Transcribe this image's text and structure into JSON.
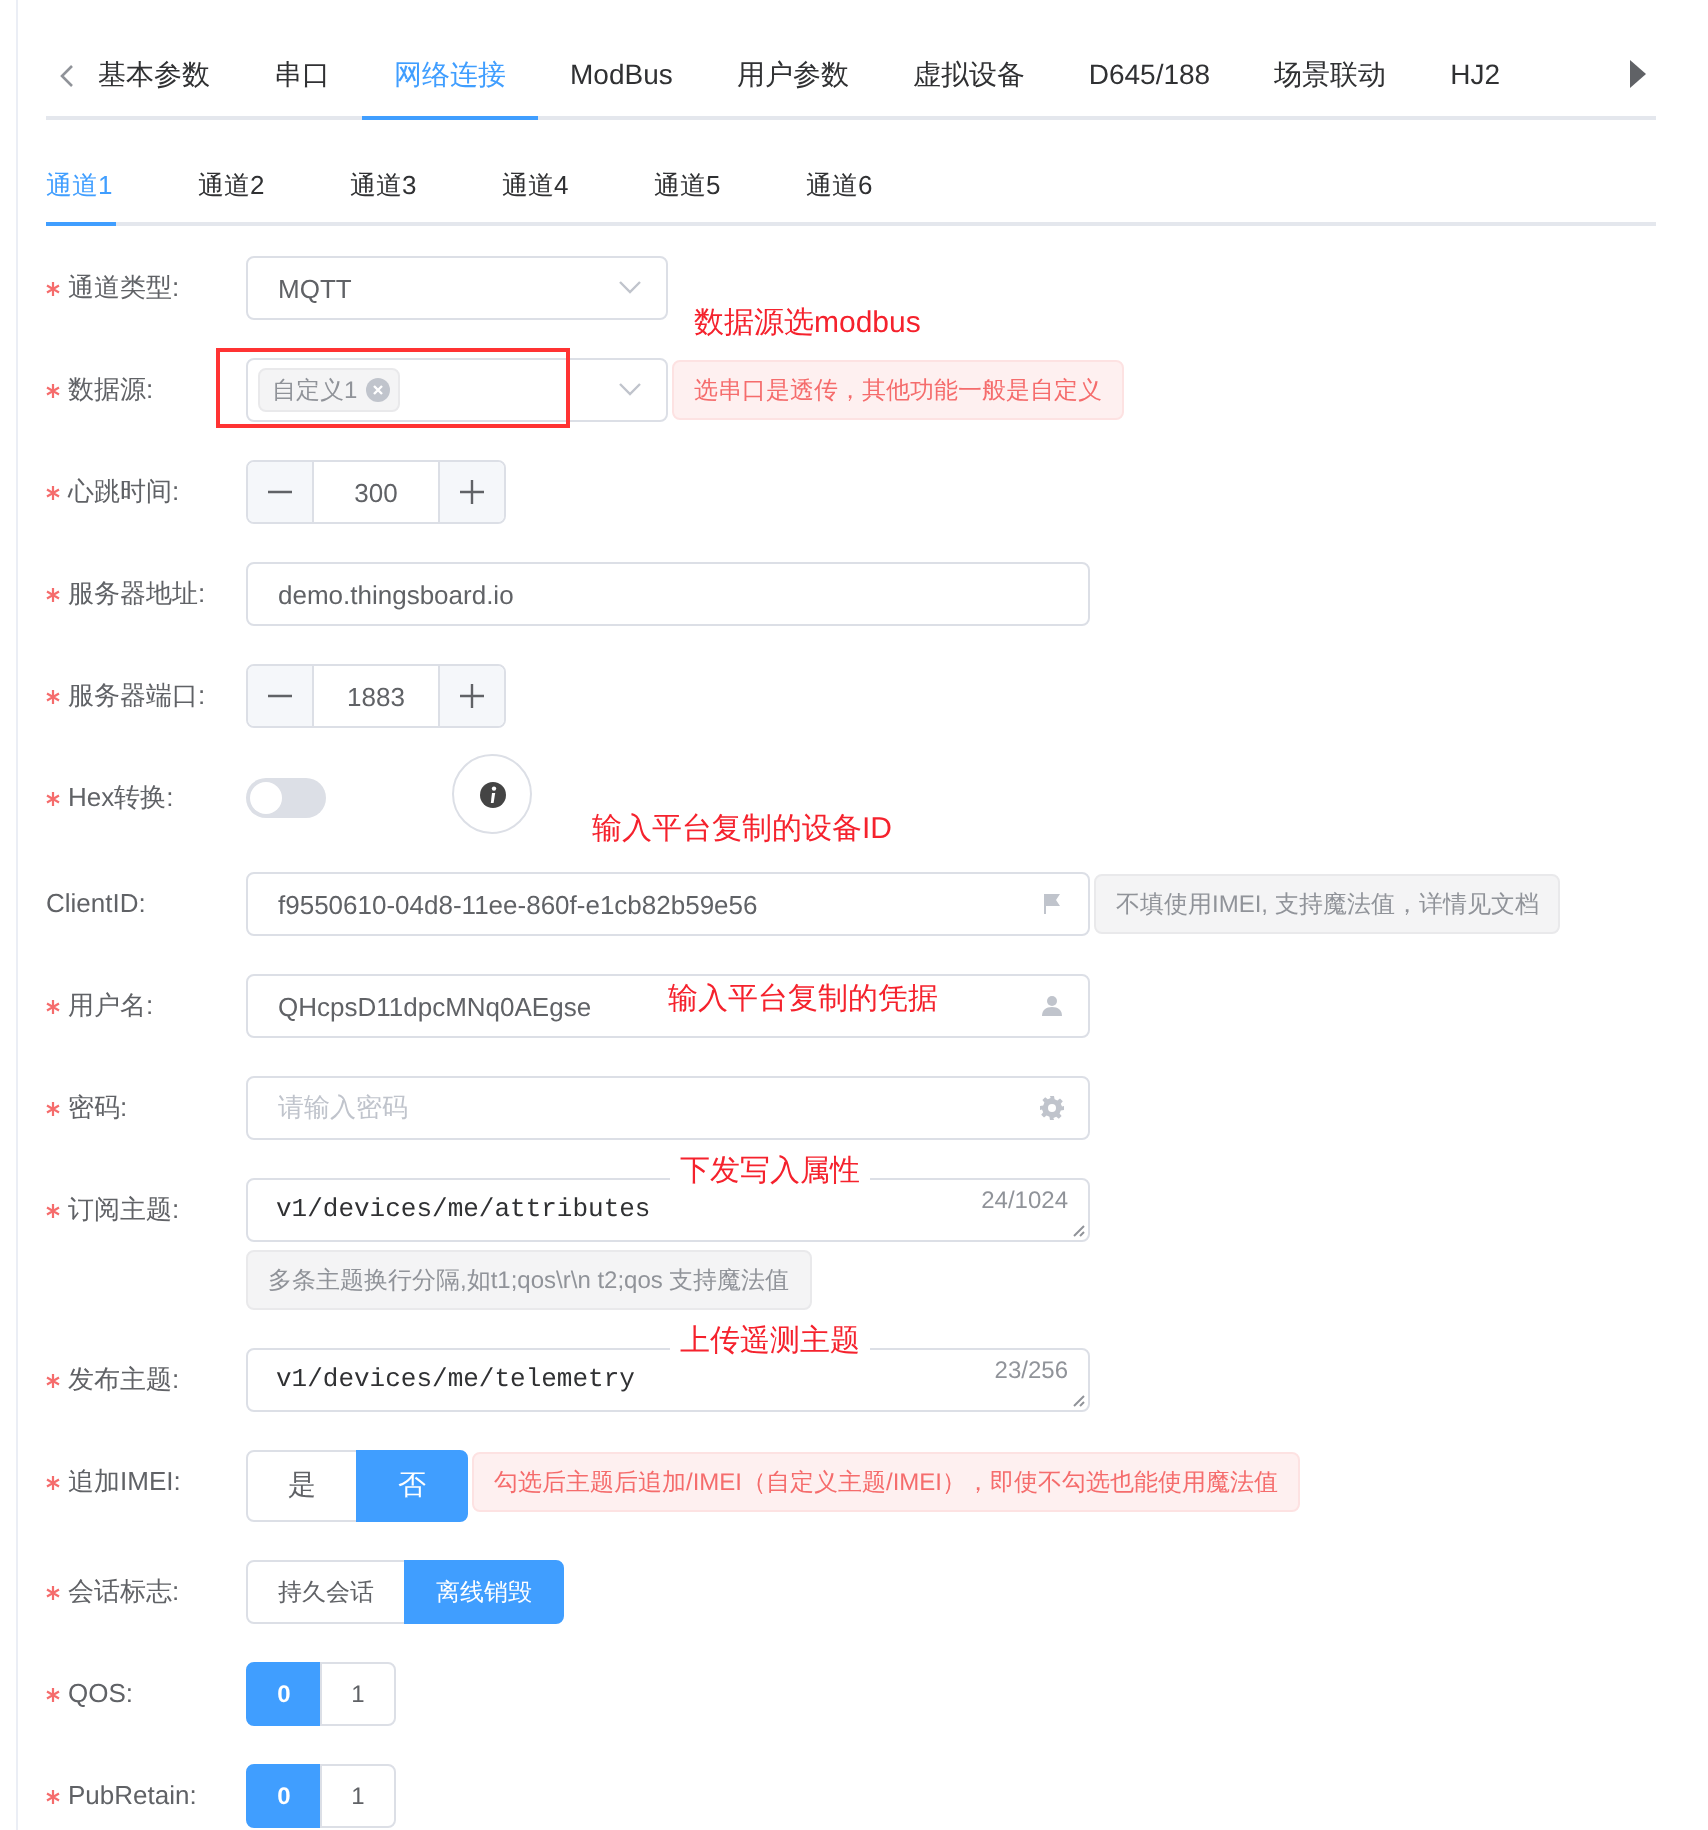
{
  "top_tabs": [
    {
      "label": "基本参数",
      "selected": false
    },
    {
      "label": "串口",
      "selected": false
    },
    {
      "label": "网络连接",
      "selected": true
    },
    {
      "label": "ModBus",
      "selected": false
    },
    {
      "label": "用户参数",
      "selected": false
    },
    {
      "label": "虚拟设备",
      "selected": false
    },
    {
      "label": "D645/188",
      "selected": false
    },
    {
      "label": "场景联动",
      "selected": false
    },
    {
      "label": "HJ2",
      "selected": false
    }
  ],
  "channel_tabs": [
    {
      "label": "通道1",
      "selected": true
    },
    {
      "label": "通道2",
      "selected": false
    },
    {
      "label": "通道3",
      "selected": false
    },
    {
      "label": "通道4",
      "selected": false
    },
    {
      "label": "通道5",
      "selected": false
    },
    {
      "label": "通道6",
      "selected": false
    }
  ],
  "form": [
    {
      "kind": "select",
      "label": "通道类型:",
      "required": true,
      "value": "MQTT",
      "annotation": "数据源选modbus"
    },
    {
      "kind": "tags",
      "label": "数据源:",
      "required": true,
      "tags": [
        "自定义1"
      ],
      "highlighted": true,
      "hint": "选串口是透传，其他功能一般是自定义"
    },
    {
      "kind": "number",
      "label": "心跳时间:",
      "required": true,
      "value": "300"
    },
    {
      "kind": "text",
      "label": "服务器地址:",
      "required": true,
      "value": "demo.thingsboard.io"
    },
    {
      "kind": "number",
      "label": "服务器端口:",
      "required": true,
      "value": "1883"
    },
    {
      "kind": "switch",
      "label": "Hex转换:",
      "required": true,
      "on": false,
      "annotation": "输入平台复制的设备ID"
    },
    {
      "kind": "clientid",
      "label": "ClientID:",
      "required": false,
      "value": "f9550610-04d8-11ee-860f-e1cb82b59e56",
      "hint": "不填使用IMEI, 支持魔法值，详情见文档"
    },
    {
      "kind": "username",
      "label": "用户名:",
      "required": true,
      "value": "QHcpsD11dpcMNq0AEgse",
      "annotation": "输入平台复制的凭据"
    },
    {
      "kind": "password",
      "label": "密码:",
      "required": true,
      "placeholder": "请输入密码"
    },
    {
      "kind": "textarea",
      "label": "订阅主题:",
      "required": true,
      "value": "v1/devices/me/attributes",
      "counter": "24/1024",
      "note": "多条主题换行分隔,如t1;qos\\r\\n t2;qos 支持魔法值",
      "annotation": "下发写入属性"
    },
    {
      "kind": "textarea",
      "label": "发布主题:",
      "required": true,
      "value": "v1/devices/me/telemetry",
      "counter": "23/256",
      "annotation": "上传遥测主题"
    },
    {
      "kind": "choice",
      "label": "追加IMEI:",
      "required": true,
      "options": [
        {
          "label": "是",
          "selected": false
        },
        {
          "label": "否",
          "selected": true
        }
      ],
      "hint": "勾选后主题后追加/IMEI（自定义主题/IMEI），即使不勾选也能使用魔法值"
    },
    {
      "kind": "segment",
      "label": "会话标志:",
      "required": true,
      "options": [
        {
          "label": "持久会话",
          "selected": false
        },
        {
          "label": "离线销毁",
          "selected": true
        }
      ]
    },
    {
      "kind": "digits",
      "label": "QOS:",
      "required": true,
      "options": [
        {
          "label": "0",
          "selected": true
        },
        {
          "label": "1",
          "selected": false
        }
      ]
    },
    {
      "kind": "digits",
      "label": "PubRetain:",
      "required": true,
      "options": [
        {
          "label": "0",
          "selected": true
        },
        {
          "label": "1",
          "selected": false
        }
      ]
    }
  ]
}
